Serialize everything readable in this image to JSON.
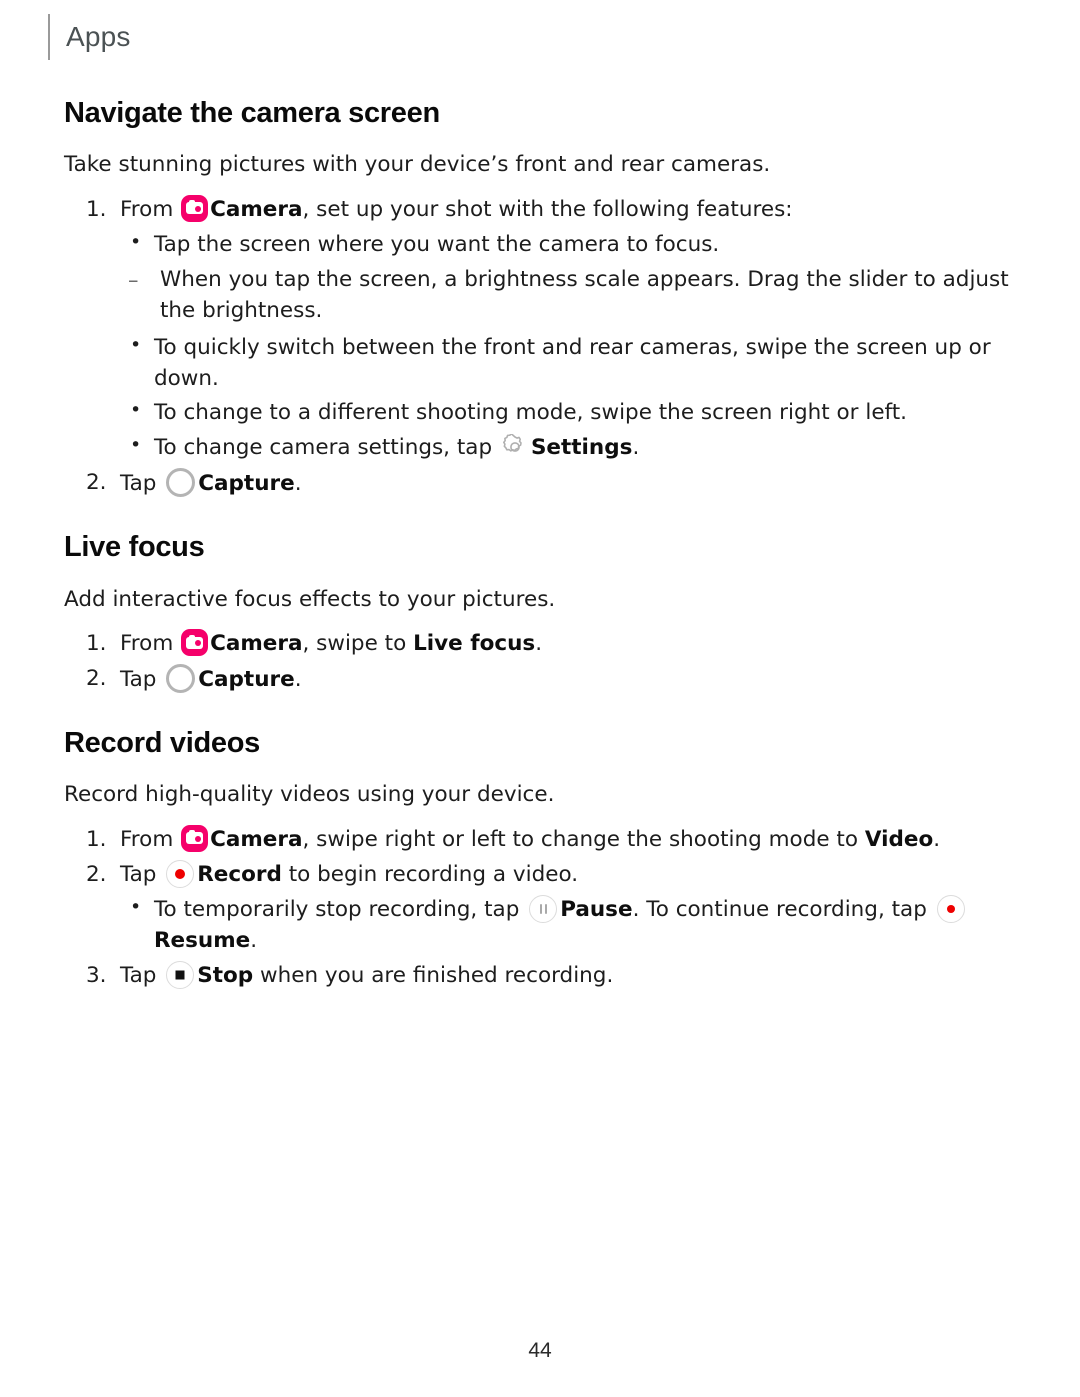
{
  "header": {
    "title": "Apps"
  },
  "footer": {
    "page_number": "44"
  },
  "colors": {
    "camera_icon_pink": "#f5006a",
    "record_dot_red": "#ee0000",
    "capture_ring_gray": "#b4b4b4",
    "header_text": "#4b5254"
  },
  "sections": [
    {
      "id": "navigate-camera-screen",
      "title": "Navigate the camera screen",
      "lead": "Take stunning pictures with your device’s front and rear cameras.",
      "step1": {
        "number": "1.",
        "text_before_icon": "From ",
        "icon": "camera-icon",
        "app_name": "Camera",
        "text_after": ", set up your shot with the following features:"
      },
      "bullets": [
        "Tap the screen where you want the camera to focus.",
        "To quickly switch between the front and rear cameras, swipe the screen up or down.",
        "To change to a different shooting mode, swipe the screen right or left."
      ],
      "dash_item": "When you tap the screen, a brightness scale appears. Drag the slider to adjust the brightness.",
      "settings_bullet": {
        "text_before_icon": "To change camera settings, tap ",
        "icon": "gear-icon",
        "label": "Settings",
        "text_after": "."
      },
      "step2": {
        "number": "2.",
        "text_before_icon": "Tap ",
        "icon": "capture-icon",
        "label": "Capture",
        "text_after": "."
      }
    },
    {
      "id": "live-focus",
      "title": "Live focus",
      "lead": "Add interactive focus effects to your pictures.",
      "step1": {
        "number": "1.",
        "text_before_icon": "From ",
        "icon": "camera-icon",
        "app_name": "Camera",
        "text_middle": ", swipe to ",
        "mode_name": "Live focus",
        "text_after": "."
      },
      "step2": {
        "number": "2.",
        "text_before_icon": "Tap ",
        "icon": "capture-icon",
        "label": "Capture",
        "text_after": "."
      }
    },
    {
      "id": "record-videos",
      "title": "Record videos",
      "lead": "Record high-quality videos using your device.",
      "step1": {
        "number": "1.",
        "text_before_icon": "From ",
        "icon": "camera-icon",
        "app_name": "Camera",
        "text_middle": ", swipe right or left to change the shooting mode to ",
        "mode_name": "Video",
        "text_after": "."
      },
      "step2": {
        "number": "2.",
        "text_before_icon": "Tap ",
        "icon": "record-icon",
        "label": "Record",
        "text_after": " to begin recording a video."
      },
      "pause_bullet": {
        "text_before_pause": "To temporarily stop recording, tap ",
        "pause_icon": "pause-icon",
        "pause_label": "Pause",
        "text_middle": ". To continue recording, tap ",
        "resume_icon": "resume-icon",
        "resume_label": "Resume",
        "text_after": "."
      },
      "step3": {
        "number": "3.",
        "text_before_icon": "Tap ",
        "icon": "stop-icon",
        "label": "Stop",
        "text_after": " when you are finished recording."
      }
    }
  ]
}
